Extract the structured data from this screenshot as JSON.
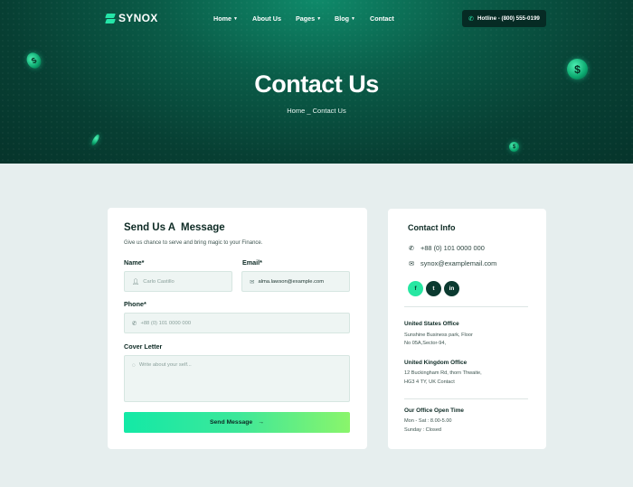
{
  "brand": {
    "name": "SYNOX"
  },
  "nav": {
    "items": [
      {
        "label": "Home",
        "dropdown": true
      },
      {
        "label": "About Us",
        "dropdown": false
      },
      {
        "label": "Pages",
        "dropdown": true
      },
      {
        "label": "Blog",
        "dropdown": true
      },
      {
        "label": "Contact",
        "dropdown": false
      }
    ],
    "hotline": "Hotline - (800) 555-0199"
  },
  "hero": {
    "title": "Contact Us",
    "breadcrumb": "Home _ Contact Us"
  },
  "form": {
    "title": "Send Us A  Message",
    "subtitle": "Give us chance to serve and bring magic to your Finance.",
    "name_label": "Name*",
    "name_placeholder": "Carlo Castillo",
    "email_label": "Email*",
    "email_value": "alma.lawson@example.com",
    "phone_label": "Phone*",
    "phone_placeholder": "+88 (0) 101 0000 000",
    "letter_label": "Cover Letter",
    "letter_placeholder": "Write about your self...",
    "send_label": "Send Message"
  },
  "info": {
    "title": "Contact Info",
    "phone": "+88 (0) 101 0000 000",
    "email": "synox@examplemail.com",
    "socials": [
      "facebook-icon",
      "twitter-icon",
      "linkedin-icon"
    ],
    "offices": [
      {
        "title": "United States Office",
        "lines": [
          "Sunshine Business park, Floor",
          "No 05A,Sector-94,"
        ]
      },
      {
        "title": "United Kingdom Office",
        "lines": [
          "12 Buckingham Rd, thorn Thwaite,",
          "HG3 4 TY, UK Contact"
        ]
      }
    ],
    "hours": {
      "title": "Our Office Open Time",
      "lines": [
        "Mon - Sat : 8.00-5.00",
        "Sunday : Closed"
      ]
    }
  },
  "colors": {
    "accent": "#25e5a8",
    "dark": "#073f33",
    "background": "#e6eeee"
  }
}
